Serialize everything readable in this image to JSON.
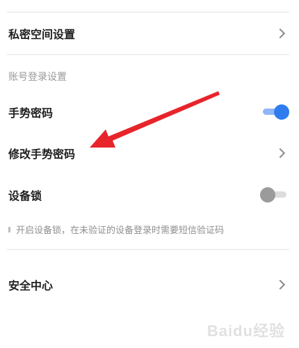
{
  "rows": {
    "private_space": {
      "label": "私密空间设置"
    },
    "gesture_password": {
      "label": "手势密码",
      "toggle_on": true
    },
    "modify_gesture_password": {
      "label": "修改手势密码"
    },
    "device_lock": {
      "label": "设备锁",
      "toggle_on": false
    },
    "security_center": {
      "label": "安全中心"
    }
  },
  "section": {
    "account_login_title": "账号登录设置"
  },
  "hint": {
    "device_lock_hint": "开启设备锁，在未验证的设备登录时需要短信验证码"
  },
  "watermark": "Baidu经验",
  "colors": {
    "toggle_on_knob": "#2f7cf0",
    "toggle_on_track": "#8fb6f6",
    "toggle_off_knob": "#9b9b9b",
    "arrow": "#e8242b"
  }
}
